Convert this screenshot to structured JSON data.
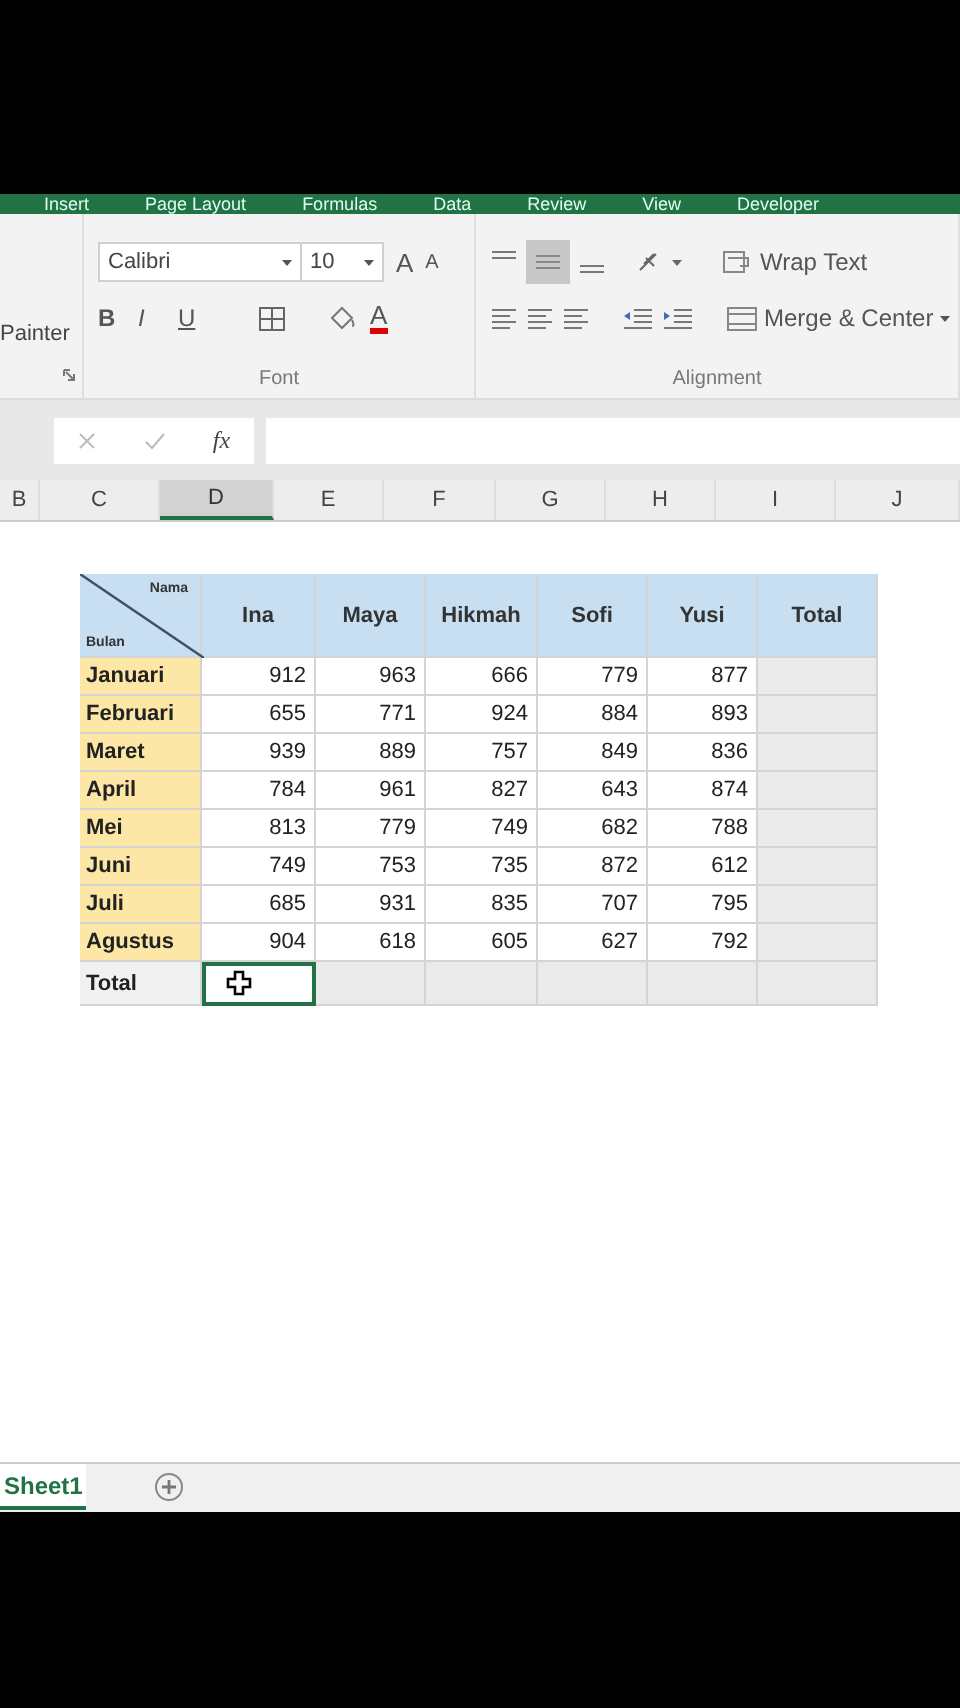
{
  "ribbon_tabs": [
    "Insert",
    "Page Layout",
    "Formulas",
    "Data",
    "Review",
    "View",
    "Developer"
  ],
  "ribbon": {
    "clipboard_label": "Painter",
    "font_name": "Calibri",
    "font_size": "10",
    "grow_font": "A",
    "shrink_font": "A",
    "format_buttons": [
      "B",
      "I",
      "U"
    ],
    "font_color": "A",
    "wrap_text": "Wrap Text",
    "merge_center": "Merge & Center",
    "groups": [
      "Font",
      "Alignment"
    ]
  },
  "formula_bar": {
    "fx_label": "fx"
  },
  "column_headers": [
    {
      "label": "B",
      "selected": false
    },
    {
      "label": "C",
      "selected": false
    },
    {
      "label": "D",
      "selected": true
    },
    {
      "label": "E",
      "selected": false
    },
    {
      "label": "F",
      "selected": false
    },
    {
      "label": "G",
      "selected": false
    },
    {
      "label": "H",
      "selected": false
    },
    {
      "label": "I",
      "selected": false
    },
    {
      "label": "J",
      "selected": false
    }
  ],
  "table": {
    "corner": {
      "top": "Nama",
      "bottom": "Bulan"
    },
    "columns": [
      "Ina",
      "Maya",
      "Hikmah",
      "Sofi",
      "Yusi",
      "Total"
    ],
    "rows": [
      {
        "month": "Januari",
        "values": [
          "912",
          "963",
          "666",
          "779",
          "877"
        ]
      },
      {
        "month": "Februari",
        "values": [
          "655",
          "771",
          "924",
          "884",
          "893"
        ]
      },
      {
        "month": "Maret",
        "values": [
          "939",
          "889",
          "757",
          "849",
          "836"
        ]
      },
      {
        "month": "April",
        "values": [
          "784",
          "961",
          "827",
          "643",
          "874"
        ]
      },
      {
        "month": "Mei",
        "values": [
          "813",
          "779",
          "749",
          "682",
          "788"
        ]
      },
      {
        "month": "Juni",
        "values": [
          "749",
          "753",
          "735",
          "872",
          "612"
        ]
      },
      {
        "month": "Juli",
        "values": [
          "685",
          "931",
          "835",
          "707",
          "795"
        ]
      },
      {
        "month": "Agustus",
        "values": [
          "904",
          "618",
          "605",
          "627",
          "792"
        ]
      }
    ],
    "total_row": {
      "label": "Total",
      "cells": [
        {
          "selected": true
        },
        {
          "selected": false
        },
        {
          "selected": false
        },
        {
          "selected": false
        },
        {
          "selected": false
        },
        {
          "selected": false
        }
      ]
    }
  },
  "sheet_tabs": [
    {
      "label": "Sheet1",
      "selected": true
    }
  ]
}
